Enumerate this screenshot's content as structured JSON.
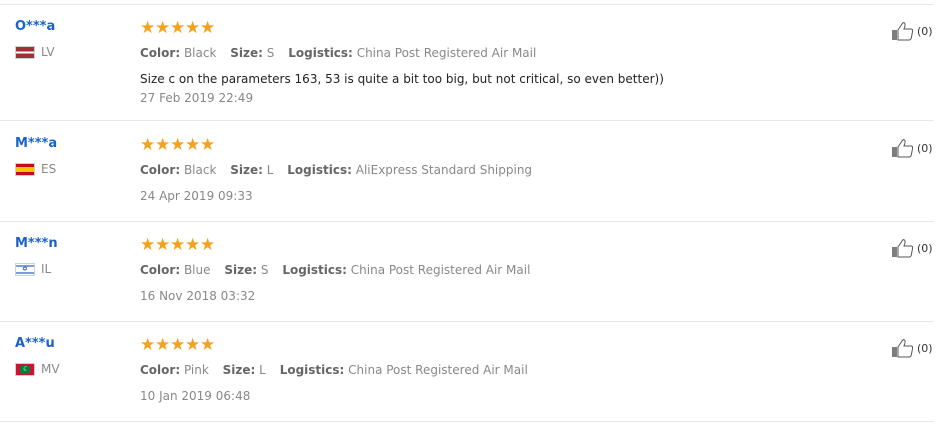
{
  "labels": {
    "color": "Color:",
    "size": "Size:",
    "logistics": "Logistics:"
  },
  "reviews": [
    {
      "user": "O***a",
      "country": "LV",
      "stars": 5,
      "color": "Black",
      "size": "S",
      "logistics": "China Post Registered Air Mail",
      "comment": "Size c on the parameters 163, 53 is quite a bit too big, but not critical, so even better))",
      "date": "27 Feb 2019 22:49",
      "helpful": "(0)"
    },
    {
      "user": "M***a",
      "country": "ES",
      "stars": 5,
      "color": "Black",
      "size": "L",
      "logistics": "AliExpress Standard Shipping",
      "comment": "",
      "date": "24 Apr 2019 09:33",
      "helpful": "(0)"
    },
    {
      "user": "M***n",
      "country": "IL",
      "stars": 5,
      "color": "Blue",
      "size": "S",
      "logistics": "China Post Registered Air Mail",
      "comment": "",
      "date": "16 Nov 2018 03:32",
      "helpful": "(0)"
    },
    {
      "user": "A***u",
      "country": "MV",
      "stars": 5,
      "color": "Pink",
      "size": "L",
      "logistics": "China Post Registered Air Mail",
      "comment": "",
      "date": "10 Jan 2019 06:48",
      "helpful": "(0)"
    }
  ],
  "colors": {
    "user_name": "#1a63c8",
    "star": "#f5a11b"
  }
}
